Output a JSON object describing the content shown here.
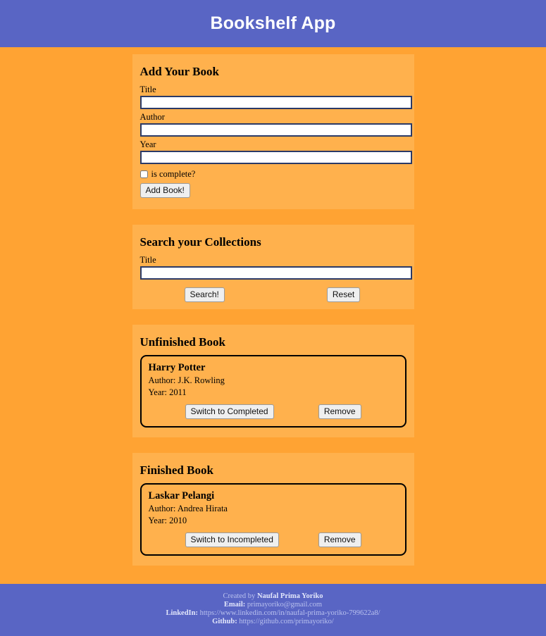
{
  "header": {
    "title": "Bookshelf App",
    "bg_color": "#5965c4",
    "text_color": "#ffffff"
  },
  "theme": {
    "page_bg": "#ffa333",
    "card_bg": "#ffb14d",
    "accent": "#5965c4",
    "input_border": "#2b3a67"
  },
  "add_book": {
    "heading": "Add Your Book",
    "title_label": "Title",
    "title_value": "",
    "title_placeholder": "",
    "author_label": "Author",
    "author_value": "",
    "author_placeholder": "",
    "year_label": "Year",
    "year_value": "",
    "year_placeholder": "",
    "complete_label": "is complete?",
    "complete_checked": false,
    "submit_label": "Add Book!"
  },
  "search": {
    "heading": "Search your Collections",
    "title_label": "Title",
    "title_value": "",
    "title_placeholder": "",
    "search_label": "Search!",
    "reset_label": "Reset"
  },
  "unfinished": {
    "heading": "Unfinished Book",
    "books": [
      {
        "title": "Harry Potter",
        "author": "Author: J.K. Rowling",
        "year": "Year: 2011",
        "switch_label": "Switch to Completed",
        "remove_label": "Remove"
      }
    ]
  },
  "finished": {
    "heading": "Finished Book",
    "books": [
      {
        "title": "Laskar Pelangi",
        "author": "Author: Andrea Hirata",
        "year": "Year: 2010",
        "switch_label": "Switch to Incompleted",
        "remove_label": "Remove"
      }
    ]
  },
  "footer": {
    "created_prefix": "Created by ",
    "created_name": "Naufal Prima Yoriko",
    "email_label": "Email:",
    "email_value": "primayoriko@gmail.com",
    "linkedin_label": "LinkedIn:",
    "linkedin_value": "https://www.linkedin.com/in/naufal-prima-yoriko-799622a8/",
    "github_label": "Github:",
    "github_value": "https://github.com/primayoriko/"
  }
}
